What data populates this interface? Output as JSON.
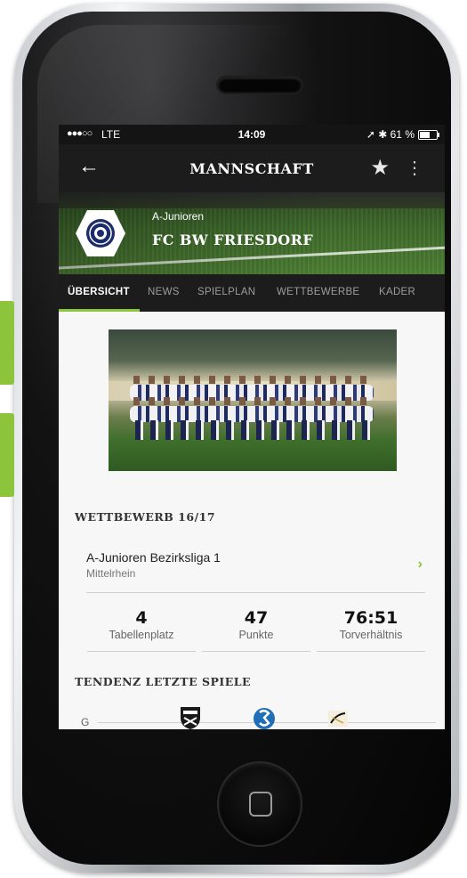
{
  "status_bar": {
    "signal": "●●●○○",
    "carrier": "LTE",
    "time": "14:09",
    "right_icons": "➚ ✱ 61 %",
    "battery_percent": 61
  },
  "app_bar": {
    "back_icon": "←",
    "title": "MANNSCHAFT",
    "favorite_icon": "★",
    "more_icon": "⋮"
  },
  "team_header": {
    "age_group": "A-Junioren",
    "club_name": "FC BW FRIESDORF"
  },
  "tabs": [
    {
      "label": "ÜBERSICHT",
      "active": true
    },
    {
      "label": "NEWS",
      "active": false
    },
    {
      "label": "SPIELPLAN",
      "active": false
    },
    {
      "label": "WETTBEWERBE",
      "active": false
    },
    {
      "label": "KADER",
      "active": false
    }
  ],
  "competition": {
    "heading": "WETTBEWERB 16/17",
    "name": "A-Junioren Bezirksliga 1",
    "region": "Mittelrhein",
    "chevron": "›"
  },
  "stats": [
    {
      "value": "4",
      "label": "Tabellenplatz"
    },
    {
      "value": "47",
      "label": "Punkte"
    },
    {
      "value": "76:51",
      "label": "Torverhältnis"
    }
  ],
  "trend": {
    "heading": "TENDENZ LETZTE SPIELE",
    "result_label": "G"
  },
  "colors": {
    "accent": "#8cc43c",
    "bar_dark": "#1c1c1c",
    "background": "#f7f7f7"
  }
}
